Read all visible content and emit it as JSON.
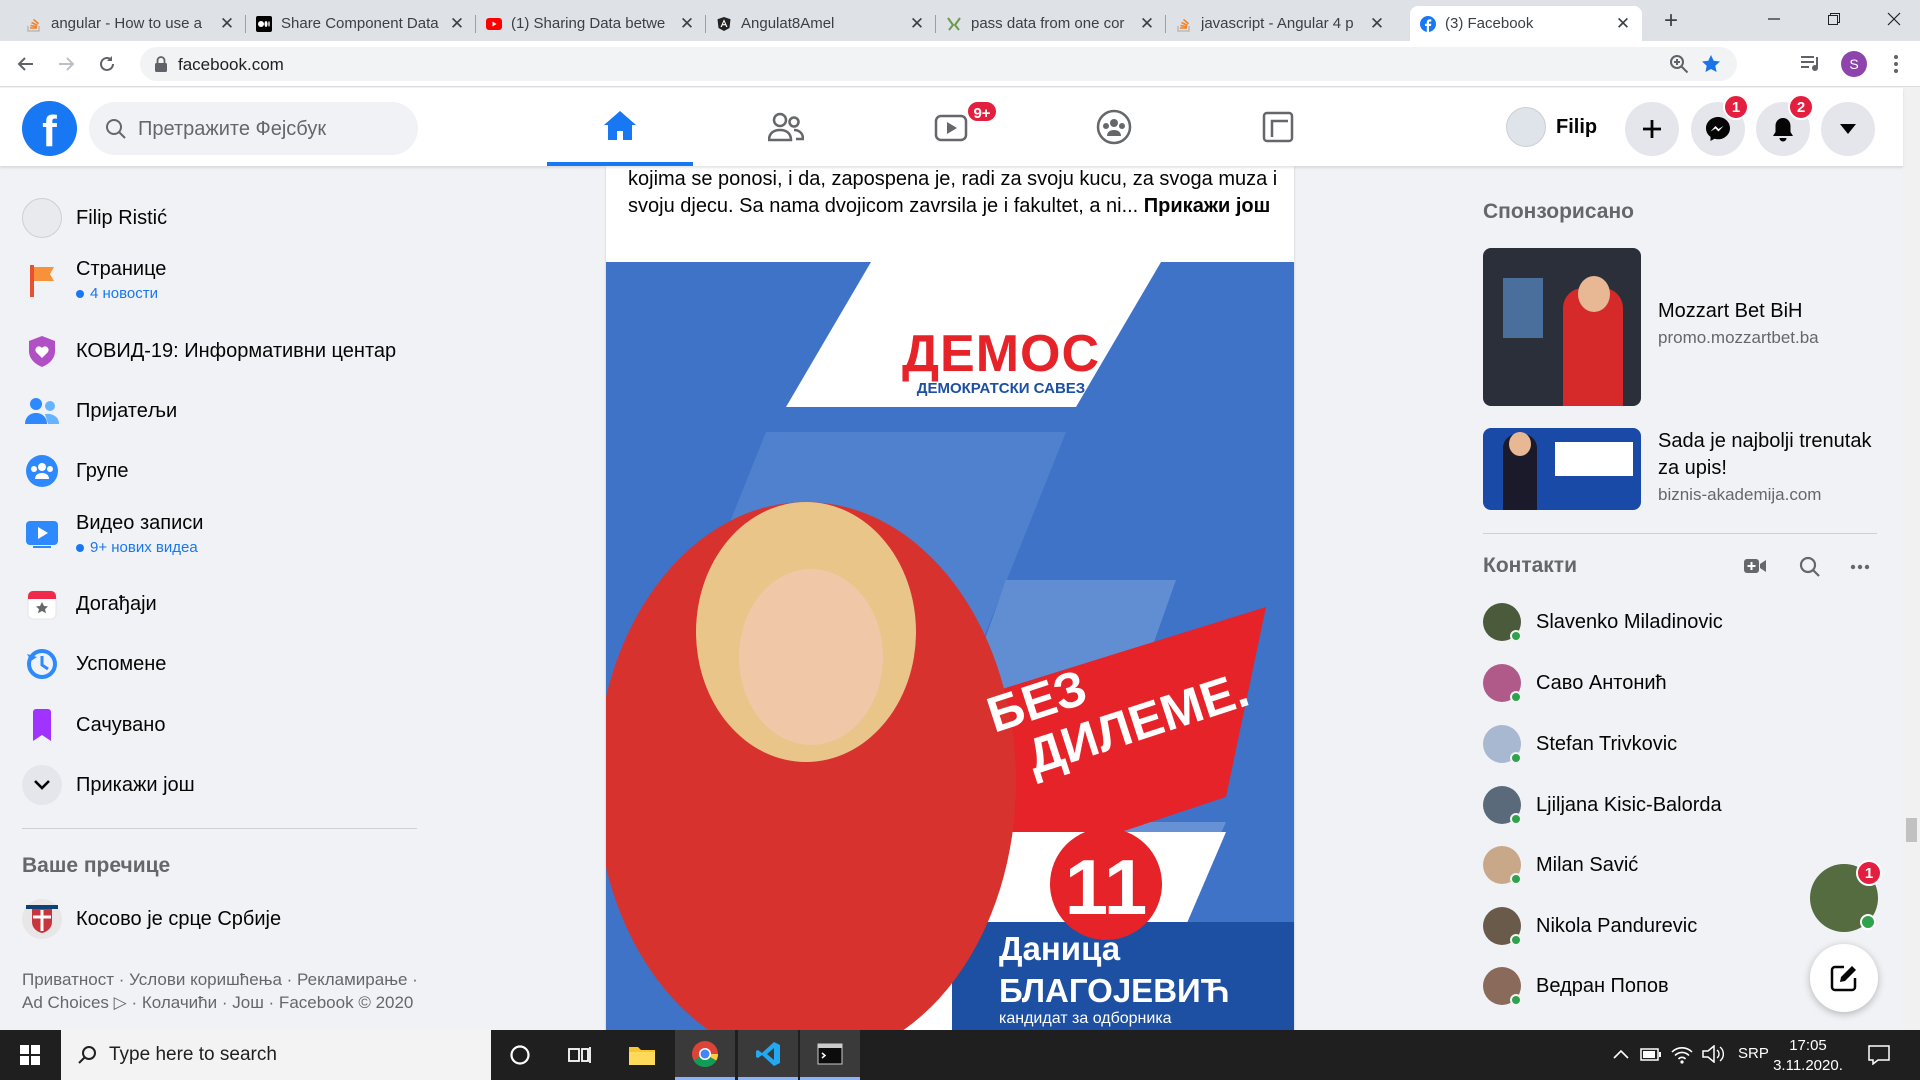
{
  "browser": {
    "tabs": [
      {
        "title": "angular - How to use a",
        "icon": "stackoverflow-icon"
      },
      {
        "title": "Share Component Data",
        "icon": "medium-icon"
      },
      {
        "title": "(1) Sharing Data betwe",
        "icon": "youtube-icon"
      },
      {
        "title": "Angulat8Amel",
        "icon": "angular-icon"
      },
      {
        "title": "pass data from one cor",
        "icon": "google-icon"
      },
      {
        "title": "javascript - Angular 4 p",
        "icon": "stackoverflow-icon"
      },
      {
        "title": "(3) Facebook",
        "icon": "facebook-icon",
        "active": true
      }
    ],
    "url": "facebook.com",
    "profile_initial": "S"
  },
  "fb": {
    "search_placeholder": "Претражите Фејсбук",
    "watch_badge": "9+",
    "user_name": "Filip",
    "messenger_badge": "1",
    "notifications_badge": "2"
  },
  "sidebar": {
    "profile": "Filip Ristić",
    "items": [
      {
        "label": "Странице",
        "sub": "4 новости",
        "icon": "pages-flag-icon"
      },
      {
        "label": "КОВИД-19: Информативни центар",
        "icon": "covid-heart-icon"
      },
      {
        "label": "Пријатељи",
        "icon": "friends-icon"
      },
      {
        "label": "Групе",
        "icon": "groups-icon"
      },
      {
        "label": "Видео записи",
        "sub": "9+ нових видеа",
        "icon": "watch-icon"
      },
      {
        "label": "Догађаји",
        "icon": "events-calendar-icon"
      },
      {
        "label": "Успомене",
        "icon": "memories-clock-icon"
      },
      {
        "label": "Сачувано",
        "icon": "saved-bookmark-icon"
      },
      {
        "label": "Прикажи још",
        "icon": "chevron-down-icon"
      }
    ],
    "shortcuts_heading": "Ваше пречице",
    "shortcut": "Косово је срце Србије",
    "footer": "Приватност · Услови коришћења · Рекламирање · Ad Choices ▷ · Колачићи · Још · Facebook © 2020"
  },
  "post": {
    "text": "kojima se ponosi, i da, zapospena je, radi za svoju kucu, za svoga muza i svoju djecu. Sa nama dvojicom zavrsila je i fakultet, a ni...",
    "see_more": "Прикажи још",
    "poster": {
      "logo": "ДЕМОС",
      "logo_sub": "ДЕМОКРАТСКИ САВЕЗ",
      "slogan_1": "БЕЗ",
      "slogan_2": "ДИЛЕМЕ.",
      "number": "11",
      "first_name": "Даница",
      "last_name": "БЛАГОЈЕВИЋ",
      "caption": "кандидат за одборника"
    }
  },
  "right": {
    "sponsored_heading": "Спонзорисано",
    "ads": [
      {
        "title": "Mozzart Bet BiH",
        "domain": "promo.mozzartbet.ba"
      },
      {
        "title": "Sada je najbolji trenutak za upis!",
        "domain": "biznis-akademija.com"
      }
    ],
    "contacts_heading": "Контакти",
    "contacts": [
      {
        "name": "Slavenko Miladinovic",
        "color": "#4a5a3a"
      },
      {
        "name": "Саво Антонић",
        "color": "#b05a8a"
      },
      {
        "name": "Stefan Trivkovic",
        "color": "#a8b8d0"
      },
      {
        "name": "Ljiljana Kisic-Balorda",
        "color": "#5a6a7a"
      },
      {
        "name": "Milan Savić",
        "color": "#c8a888"
      },
      {
        "name": "Nikola Pandurevic",
        "color": "#6a5a4a"
      },
      {
        "name": "Ведран Попов",
        "color": "#8a6a5a"
      }
    ],
    "chat_badge": "1"
  },
  "taskbar": {
    "search_placeholder": "Type here to search",
    "lang": "SRP",
    "time": "17:05",
    "date": "3.11.2020."
  },
  "colors": {
    "fb_blue": "#1877f2",
    "badge_red": "#e41e3f",
    "poster_blue": "#3b6fc4",
    "poster_red": "#e52329"
  }
}
